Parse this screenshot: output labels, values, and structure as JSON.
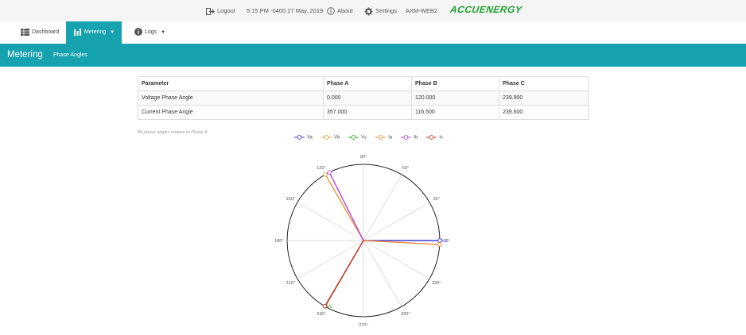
{
  "topbar": {
    "logout_label": "Logout",
    "datetime": "5:15 PM -0400 27 May, 2019",
    "about_label": "About",
    "settings_label": "Settings",
    "device_name": "AXM-WEB2",
    "logo_text": "ACCUENERGY"
  },
  "nav": {
    "dashboard_label": "Dashboard",
    "metering_label": "Metering",
    "logs_label": "Logs"
  },
  "banner": {
    "title": "Metering",
    "subtitle": "Phase Angles"
  },
  "table": {
    "headers": [
      "Parameter",
      "Phase A",
      "Phase B",
      "Phase C"
    ],
    "rows": [
      [
        "Voltage Phase Angle",
        "0.000",
        "120.000",
        "239.900"
      ],
      [
        "Current Phase Angle",
        "357.000",
        "116.500",
        "239.600"
      ]
    ]
  },
  "note": "All phase angles relative to Phase A",
  "chart_data": {
    "type": "polar",
    "angle_ticks": [
      "90°",
      "60°",
      "30°",
      "0°",
      "330°",
      "300°",
      "270°",
      "240°",
      "210°",
      "180°",
      "150°",
      "120°"
    ],
    "series": [
      {
        "name": "Va",
        "angle": 0.0,
        "magnitude": 1.0,
        "color": "#3b3bd9"
      },
      {
        "name": "Vb",
        "angle": 120.0,
        "magnitude": 1.0,
        "color": "#e0a030"
      },
      {
        "name": "Vc",
        "angle": 239.9,
        "magnitude": 1.0,
        "color": "#2ea82e"
      },
      {
        "name": "Ia",
        "angle": 357.0,
        "magnitude": 1.0,
        "color": "#f08a3a"
      },
      {
        "name": "Ib",
        "angle": 116.5,
        "magnitude": 1.0,
        "color": "#c040e0"
      },
      {
        "name": "Ic",
        "angle": 239.6,
        "magnitude": 1.0,
        "color": "#d83030"
      }
    ],
    "point_labels": {
      "Va": "Va",
      "Vc": "Vc"
    }
  }
}
